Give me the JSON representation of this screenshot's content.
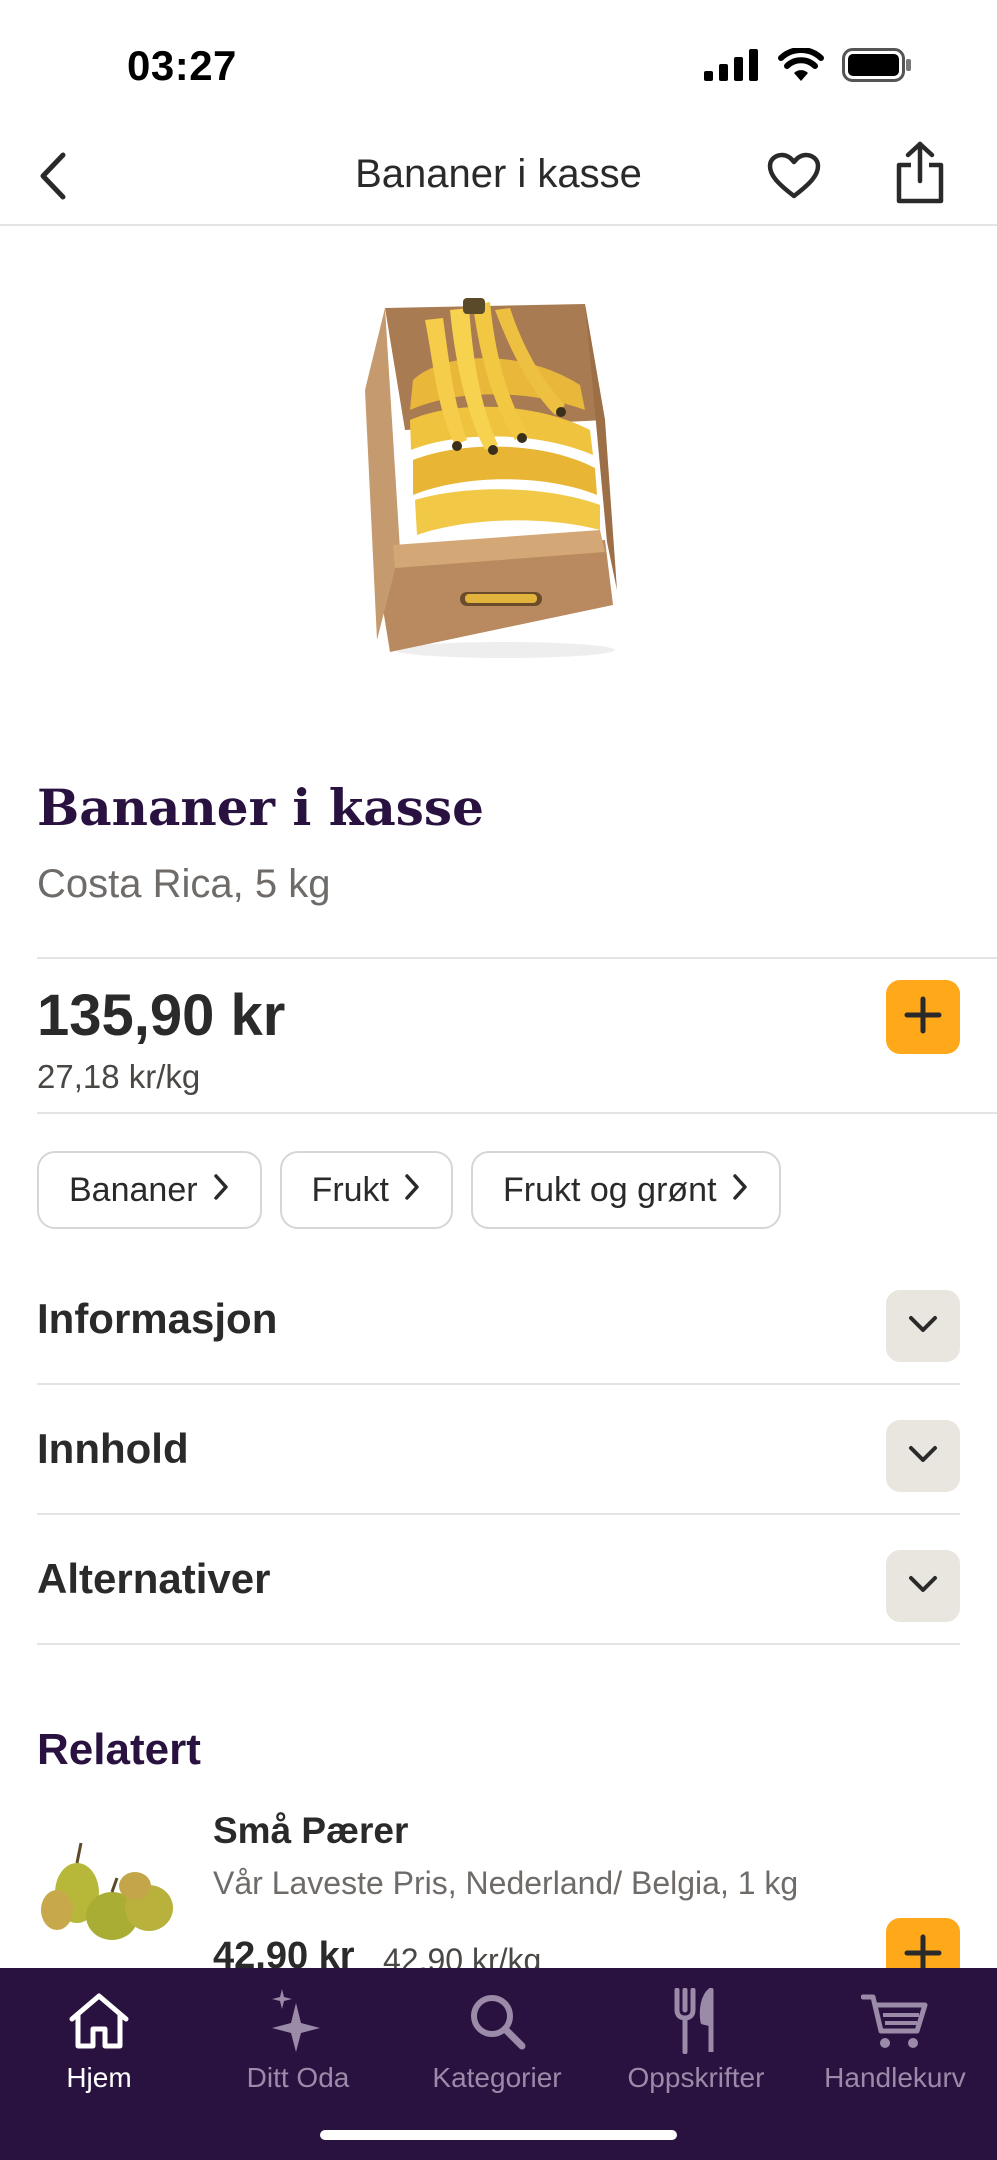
{
  "status_bar": {
    "time": "03:27"
  },
  "header": {
    "title": "Bananer i kasse"
  },
  "product": {
    "name": "Bananer i kasse",
    "subtitle": "Costa Rica, 5 kg",
    "price": "135,90 kr",
    "unit_price": "27,18 kr/kg"
  },
  "chips": [
    {
      "label": "Bananer"
    },
    {
      "label": "Frukt"
    },
    {
      "label": "Frukt og grønt"
    }
  ],
  "accordions": [
    {
      "label": "Informasjon"
    },
    {
      "label": "Innhold"
    },
    {
      "label": "Alternativer"
    }
  ],
  "related": {
    "title": "Relatert",
    "items": [
      {
        "name": "Små Pærer",
        "subtitle": "Vår Laveste Pris,  Nederland/ Belgia, 1 kg",
        "price": "42,90 kr",
        "unit_price": "42,90 kr/kg"
      }
    ]
  },
  "nav": [
    {
      "label": "Hjem",
      "icon": "home-icon",
      "active": true
    },
    {
      "label": "Ditt Oda",
      "icon": "sparkle-icon",
      "active": false
    },
    {
      "label": "Kategorier",
      "icon": "search-icon",
      "active": false
    },
    {
      "label": "Oppskrifter",
      "icon": "fork-knife-icon",
      "active": false
    },
    {
      "label": "Handlekurv",
      "icon": "cart-icon",
      "active": false
    }
  ],
  "colors": {
    "accent": "#ffa81a",
    "brand_purple": "#2a1240",
    "nav_inactive": "#9b8aa8"
  }
}
